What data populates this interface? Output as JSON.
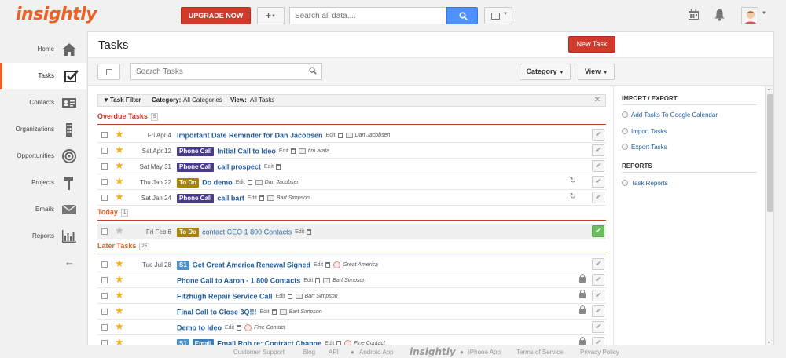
{
  "app": {
    "logo": "insightly",
    "brand_color": "#e96125"
  },
  "header": {
    "upgrade_label": "UPGRADE NOW",
    "plus_label": "+",
    "search_placeholder": "Search all data....",
    "icons": [
      "calendar-icon",
      "bell-icon",
      "avatar"
    ]
  },
  "sidebar": {
    "items": [
      {
        "label": "Home",
        "icon": "home-icon"
      },
      {
        "label": "Tasks",
        "icon": "tasks-icon",
        "active": true
      },
      {
        "label": "Contacts",
        "icon": "contacts-icon"
      },
      {
        "label": "Organizations",
        "icon": "organizations-icon"
      },
      {
        "label": "Opportunities",
        "icon": "target-icon"
      },
      {
        "label": "Projects",
        "icon": "hammer-icon"
      },
      {
        "label": "Emails",
        "icon": "envelope-icon"
      },
      {
        "label": "Reports",
        "icon": "chart-icon"
      }
    ]
  },
  "page": {
    "title": "Tasks",
    "new_task_label": "New Task",
    "search_placeholder": "Search Tasks",
    "category_label": "Category",
    "view_label": "View"
  },
  "filter": {
    "label": "Task Filter",
    "category_key": "Category:",
    "category_value": "All Categories",
    "view_key": "View:",
    "view_value": "All Tasks"
  },
  "groups": {
    "overdue": {
      "title": "Overdue Tasks",
      "count": "5"
    },
    "today": {
      "title": "Today",
      "count": "1"
    },
    "later": {
      "title": "Later Tasks",
      "count": "25"
    }
  },
  "overdue_tasks": [
    {
      "date": "Fri Apr 4",
      "badges": [],
      "title": "Important Date Reminder for Dan Jacobsen",
      "edit": "Edit",
      "who": "Dan Jacobsen",
      "who_type": "contact"
    },
    {
      "date": "Sat Apr 12",
      "badges": [
        "Phone Call"
      ],
      "title": "Initial Call to Ideo",
      "edit": "Edit",
      "who": "tim arata",
      "who_type": "contact"
    },
    {
      "date": "Sat May 31",
      "badges": [
        "Phone Call"
      ],
      "title": "call prospect",
      "edit": "Edit",
      "who": "",
      "who_type": ""
    },
    {
      "date": "Thu Jan 22",
      "badges": [
        "To Do"
      ],
      "title": "Do demo",
      "edit": "Edit",
      "who": "Dan Jacobsen",
      "who_type": "contact",
      "recurring": true
    },
    {
      "date": "Sat Jan 24",
      "badges": [
        "Phone Call"
      ],
      "title": "call bart",
      "edit": "Edit",
      "who": "Bart Simpson",
      "who_type": "contact",
      "recurring": true
    }
  ],
  "today_tasks": [
    {
      "date": "Fri Feb 6",
      "badges": [
        "To Do"
      ],
      "title": "contact CEO 1 800 Contacts",
      "edit": "Edit",
      "completed": true
    }
  ],
  "later_tasks": [
    {
      "date": "Tue Jul 28",
      "badges": [
        "S1"
      ],
      "title": "Get Great America Renewal Signed",
      "edit": "Edit",
      "who": "Great America",
      "who_type": "org"
    },
    {
      "date": "",
      "badges": [],
      "title": "Phone Call to Aaron - 1 800 Contacts",
      "edit": "Edit",
      "who": "Bart Simpson",
      "who_type": "contact",
      "locked": true
    },
    {
      "date": "",
      "badges": [],
      "title": "Fitzhugh Repair Service Call",
      "edit": "Edit",
      "who": "Bart Simpson",
      "who_type": "contact",
      "locked": true
    },
    {
      "date": "",
      "badges": [],
      "title": "Final Call to Close 3Q!!!",
      "edit": "Edit",
      "who": "Bart Simpson",
      "who_type": "contact",
      "locked": true
    },
    {
      "date": "",
      "badges": [],
      "title": "Demo to Ideo",
      "edit": "Edit",
      "who": "Fine Contact",
      "who_type": "org"
    },
    {
      "date": "",
      "badges": [
        "S1",
        "Email"
      ],
      "title": "Email Rob re: Contract Change",
      "edit": "Edit",
      "who": "Fine Contact",
      "who_type": "org",
      "locked": true
    }
  ],
  "right_panel": {
    "import_export_title": "IMPORT / EXPORT",
    "links": [
      "Add Tasks To Google Calendar",
      "Import Tasks",
      "Export Tasks"
    ],
    "reports_title": "REPORTS",
    "report_links": [
      "Task Reports"
    ]
  },
  "footer": {
    "links": [
      "Customer Support",
      "Blog",
      "API",
      "Android App",
      "insightly",
      "iPhone App",
      "Terms of Service",
      "Privacy Policy"
    ]
  },
  "colors": {
    "phone_call": "#4a3a8c",
    "to_do": "#a8820d",
    "s1": "#4a90c9",
    "email": "#3d7fb5",
    "overdue_red": "#c0392b",
    "done_green": "#6cbf60"
  }
}
